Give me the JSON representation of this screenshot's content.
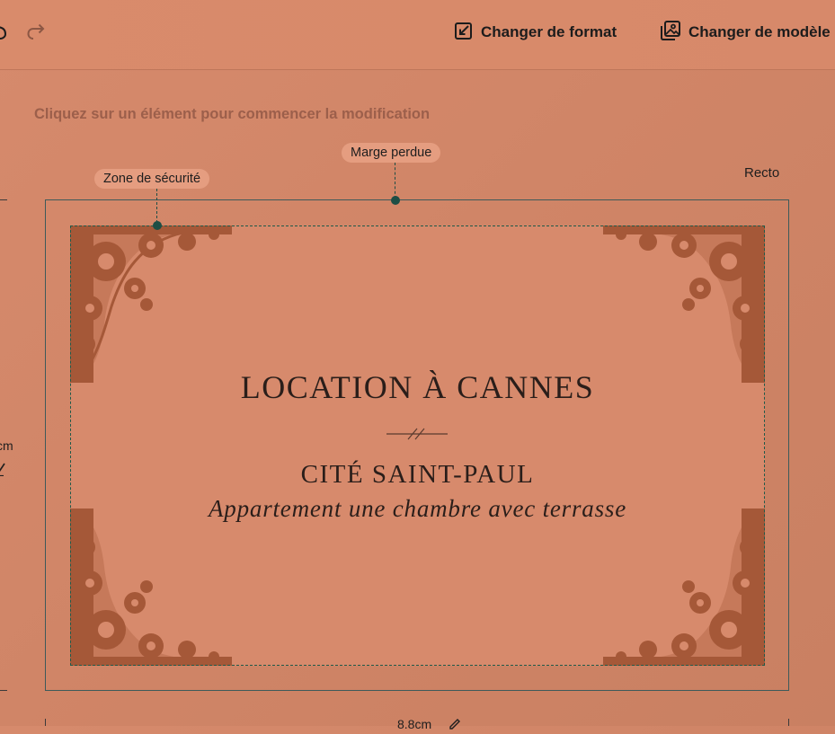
{
  "toolbar": {
    "change_format_label": "Changer de format",
    "change_template_label": "Changer de modèle"
  },
  "editor": {
    "hint": "Cliquez sur un élément pour commencer la modification",
    "safety_zone_label": "Zone de sécurité",
    "bleed_label": "Marge perdue",
    "side_label": "Recto",
    "height_dimension": "cm",
    "width_dimension": "8.8cm"
  },
  "card": {
    "title": "LOCATION À CANNES",
    "subtitle": "CITÉ SAINT-PAUL",
    "tagline": "Appartement une chambre avec terrasse"
  },
  "colors": {
    "background": "#d68a6c",
    "ornament": "#a55838",
    "guide": "#1d4e45",
    "pill": "#e59d80"
  }
}
